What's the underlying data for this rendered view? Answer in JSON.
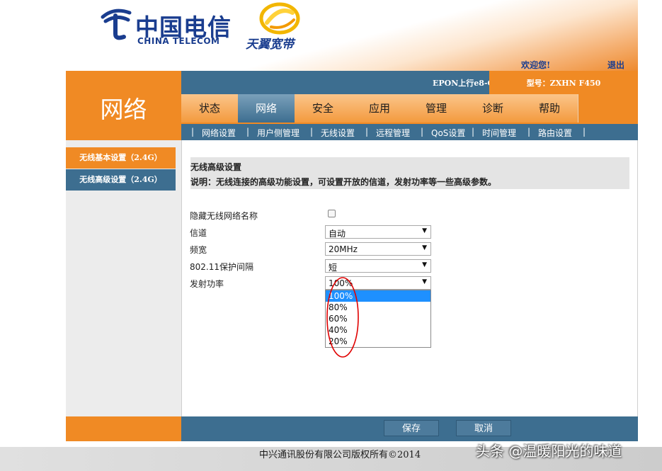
{
  "header": {
    "logo_cn": "中国电信",
    "logo_en": "CHINA TELECOM",
    "brand": "天翼宽带",
    "welcome": "欢迎您!",
    "logout": "退出"
  },
  "section_title_big": "网络",
  "topbar": {
    "epon": "EPON上行e8-C",
    "model": "型号：ZXHN F450"
  },
  "tabs": [
    {
      "label": "状态",
      "active": false
    },
    {
      "label": "网络",
      "active": true
    },
    {
      "label": "安全",
      "active": false
    },
    {
      "label": "应用",
      "active": false
    },
    {
      "label": "管理",
      "active": false
    },
    {
      "label": "诊断",
      "active": false
    },
    {
      "label": "帮助",
      "active": false
    }
  ],
  "submenu": [
    "网络设置",
    "用户侧管理",
    "无线设置",
    "远程管理",
    "QoS设置",
    "时间管理",
    "路由设置"
  ],
  "leftnav": [
    "无线基本设置（2.4G）",
    "无线高级设置（2.4G）"
  ],
  "content": {
    "title": "无线高级设置",
    "desc": "说明：无线连接的高级功能设置，可设置开放的信道，发射功率等一些高级参数。",
    "fields": {
      "hide_ssid": {
        "label": "隐藏无线网络名称",
        "checked": false
      },
      "channel": {
        "label": "信道",
        "value": "自动"
      },
      "bandwidth": {
        "label": "频宽",
        "value": "20MHz"
      },
      "guard": {
        "label": "802.11保护间隔",
        "value": "短"
      },
      "power": {
        "label": "发射功率",
        "value": "100%"
      }
    },
    "power_options": [
      "100%",
      "80%",
      "60%",
      "40%",
      "20%"
    ],
    "power_highlighted": "100%"
  },
  "buttons": {
    "save": "保存",
    "cancel": "取消"
  },
  "footer": {
    "copyright": "中兴通讯股份有限公司版权所有©2014",
    "watermark": "头条 @温暖阳光的味道"
  },
  "colors": {
    "orange": "#f08a24",
    "blue": "#3d6e90",
    "highlight": "#1e90ff",
    "annotation": "#e00000"
  }
}
